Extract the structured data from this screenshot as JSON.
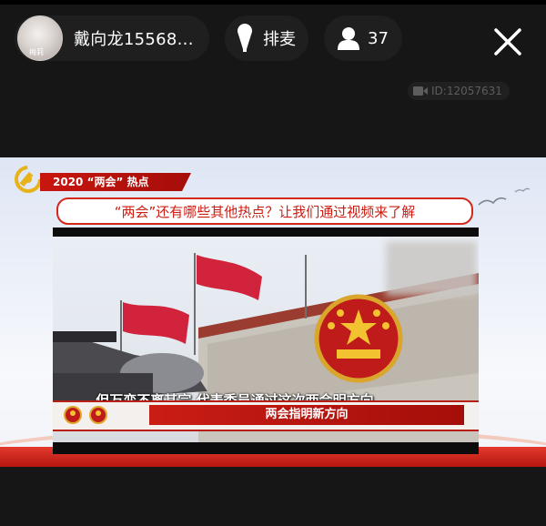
{
  "host": {
    "name": "戴向龙15568...",
    "avatar_label": "梅莉"
  },
  "mic_queue": {
    "label": "排麦"
  },
  "viewers": {
    "count": "37"
  },
  "room": {
    "id_text": "ID:12057631"
  },
  "video": {
    "tag": "2020 “两会” 热点",
    "headline": "“两会”还有哪些其他热点？让我们通过视频来了解",
    "subtitle": "但万变不离其宗 代表委员通过这次两会明方向",
    "lower_title": "两会指明新方向"
  },
  "icons": {
    "mic": "microphone-icon",
    "viewers": "user-icon",
    "close": "close-icon",
    "room": "video-camera-icon"
  },
  "colors": {
    "background": "#161616",
    "pill": "#1f1f1f",
    "accent_red": "#c8160f"
  }
}
